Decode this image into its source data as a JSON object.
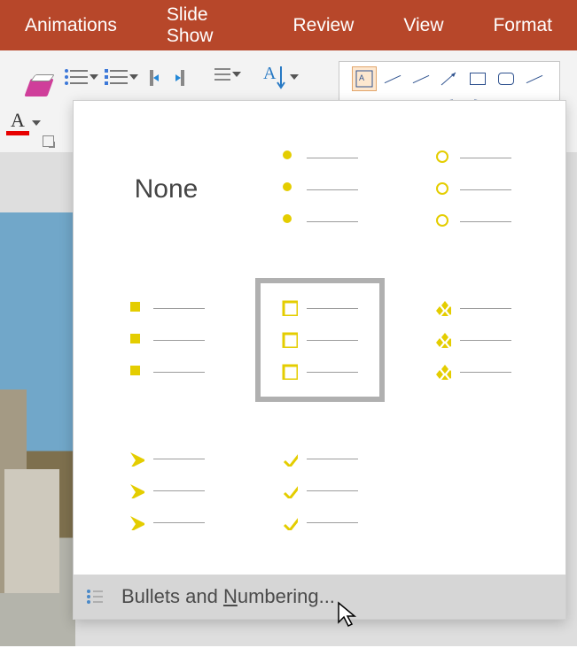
{
  "ribbon": {
    "tabs": [
      "Animations",
      "Slide Show",
      "Review",
      "View",
      "Format"
    ],
    "buttons": {
      "clear_formatting": "Clear All Formatting",
      "font_color": "Font Color",
      "bullets": "Bullets",
      "numbering": "Numbering",
      "decrease_indent": "Decrease List Level",
      "increase_indent": "Increase List Level",
      "line_spacing": "Line Spacing",
      "text_direction": "Text Direction",
      "launcher": "Font Dialog Launcher"
    },
    "font_color_glyph": "A",
    "font_color_value": "#e70000"
  },
  "bullet_gallery": {
    "none_label": "None",
    "options": [
      {
        "id": "disc",
        "type": "disc",
        "color": "#e4cd00",
        "selected": false
      },
      {
        "id": "ring",
        "type": "ring",
        "color": "#e4cd00",
        "selected": false
      },
      {
        "id": "square-fill",
        "type": "square-fill",
        "color": "#e4cd00",
        "selected": false
      },
      {
        "id": "square-hollow",
        "type": "square-hollow",
        "color": "#e4cd00",
        "selected": true
      },
      {
        "id": "diamond-cluster",
        "type": "diamond-cluster",
        "color": "#e4cd00",
        "selected": false
      },
      {
        "id": "arrowhead",
        "type": "arrowhead",
        "color": "#e4cd00",
        "selected": false
      },
      {
        "id": "check",
        "type": "check",
        "color": "#e4cd00",
        "selected": false
      }
    ],
    "footer_label_pre": "Bullets and ",
    "footer_label_under": "N",
    "footer_label_post": "umbering..."
  },
  "shapes": {
    "items": [
      "textbox",
      "line",
      "line",
      "arrow",
      "rect",
      "rrect",
      "line",
      "line",
      "lbrace",
      "rbrace",
      "star"
    ]
  }
}
